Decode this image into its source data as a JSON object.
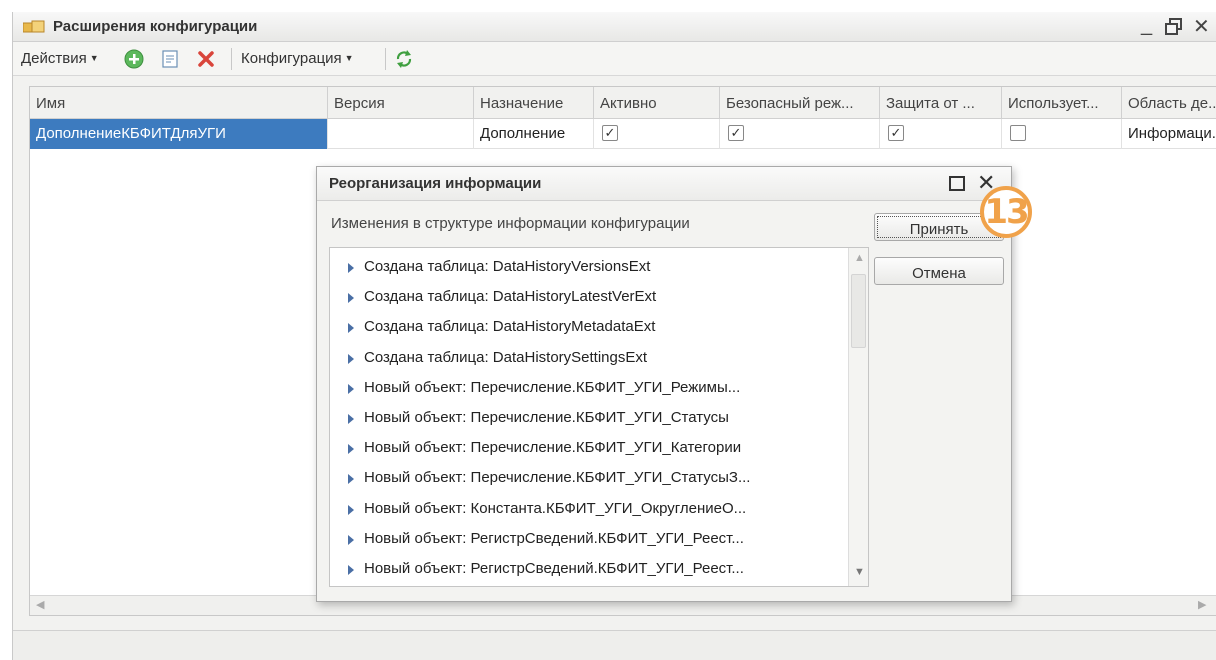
{
  "window": {
    "title": "Расширения конфигурации",
    "min_glyph": "_",
    "close_glyph": "✕"
  },
  "toolbar": {
    "actions_label": "Действия",
    "config_label": "Конфигурация"
  },
  "grid": {
    "columns": [
      "Имя",
      "Версия",
      "Назначение",
      "Активно",
      "Безопасный реж...",
      "Защита от ...",
      "Использует...",
      "Область де..."
    ],
    "row": {
      "name": "ДополнениеКБФИТДляУГИ",
      "version": "",
      "purpose": "Дополнение",
      "active": true,
      "safe_mode": true,
      "protection": true,
      "uses": false,
      "scope": "Информаци..."
    },
    "check_glyph": "✓"
  },
  "dialog": {
    "title": "Реорганизация информации",
    "close_glyph": "✕",
    "subtitle": "Изменения в структуре информации конфигурации",
    "accept_label": "Принять",
    "cancel_label": "Отмена",
    "items": [
      "Создана таблица: DataHistoryVersionsExt",
      "Создана таблица: DataHistoryLatestVerExt",
      "Создана таблица: DataHistoryMetadataExt",
      "Создана таблица: DataHistorySettingsExt",
      "Новый объект: Перечисление.КБФИТ_УГИ_Режимы...",
      "Новый объект: Перечисление.КБФИТ_УГИ_Статусы",
      "Новый объект: Перечисление.КБФИТ_УГИ_Категории",
      "Новый объект: Перечисление.КБФИТ_УГИ_СтатусыЗ...",
      "Новый объект: Константа.КБФИТ_УГИ_ОкруглениеО...",
      "Новый объект: РегистрСведений.КБФИТ_УГИ_Реест...",
      "Новый объект: РегистрСведений.КБФИТ_УГИ_Реест..."
    ]
  },
  "annotation": {
    "step": "13",
    "color": "#f0a24a"
  }
}
